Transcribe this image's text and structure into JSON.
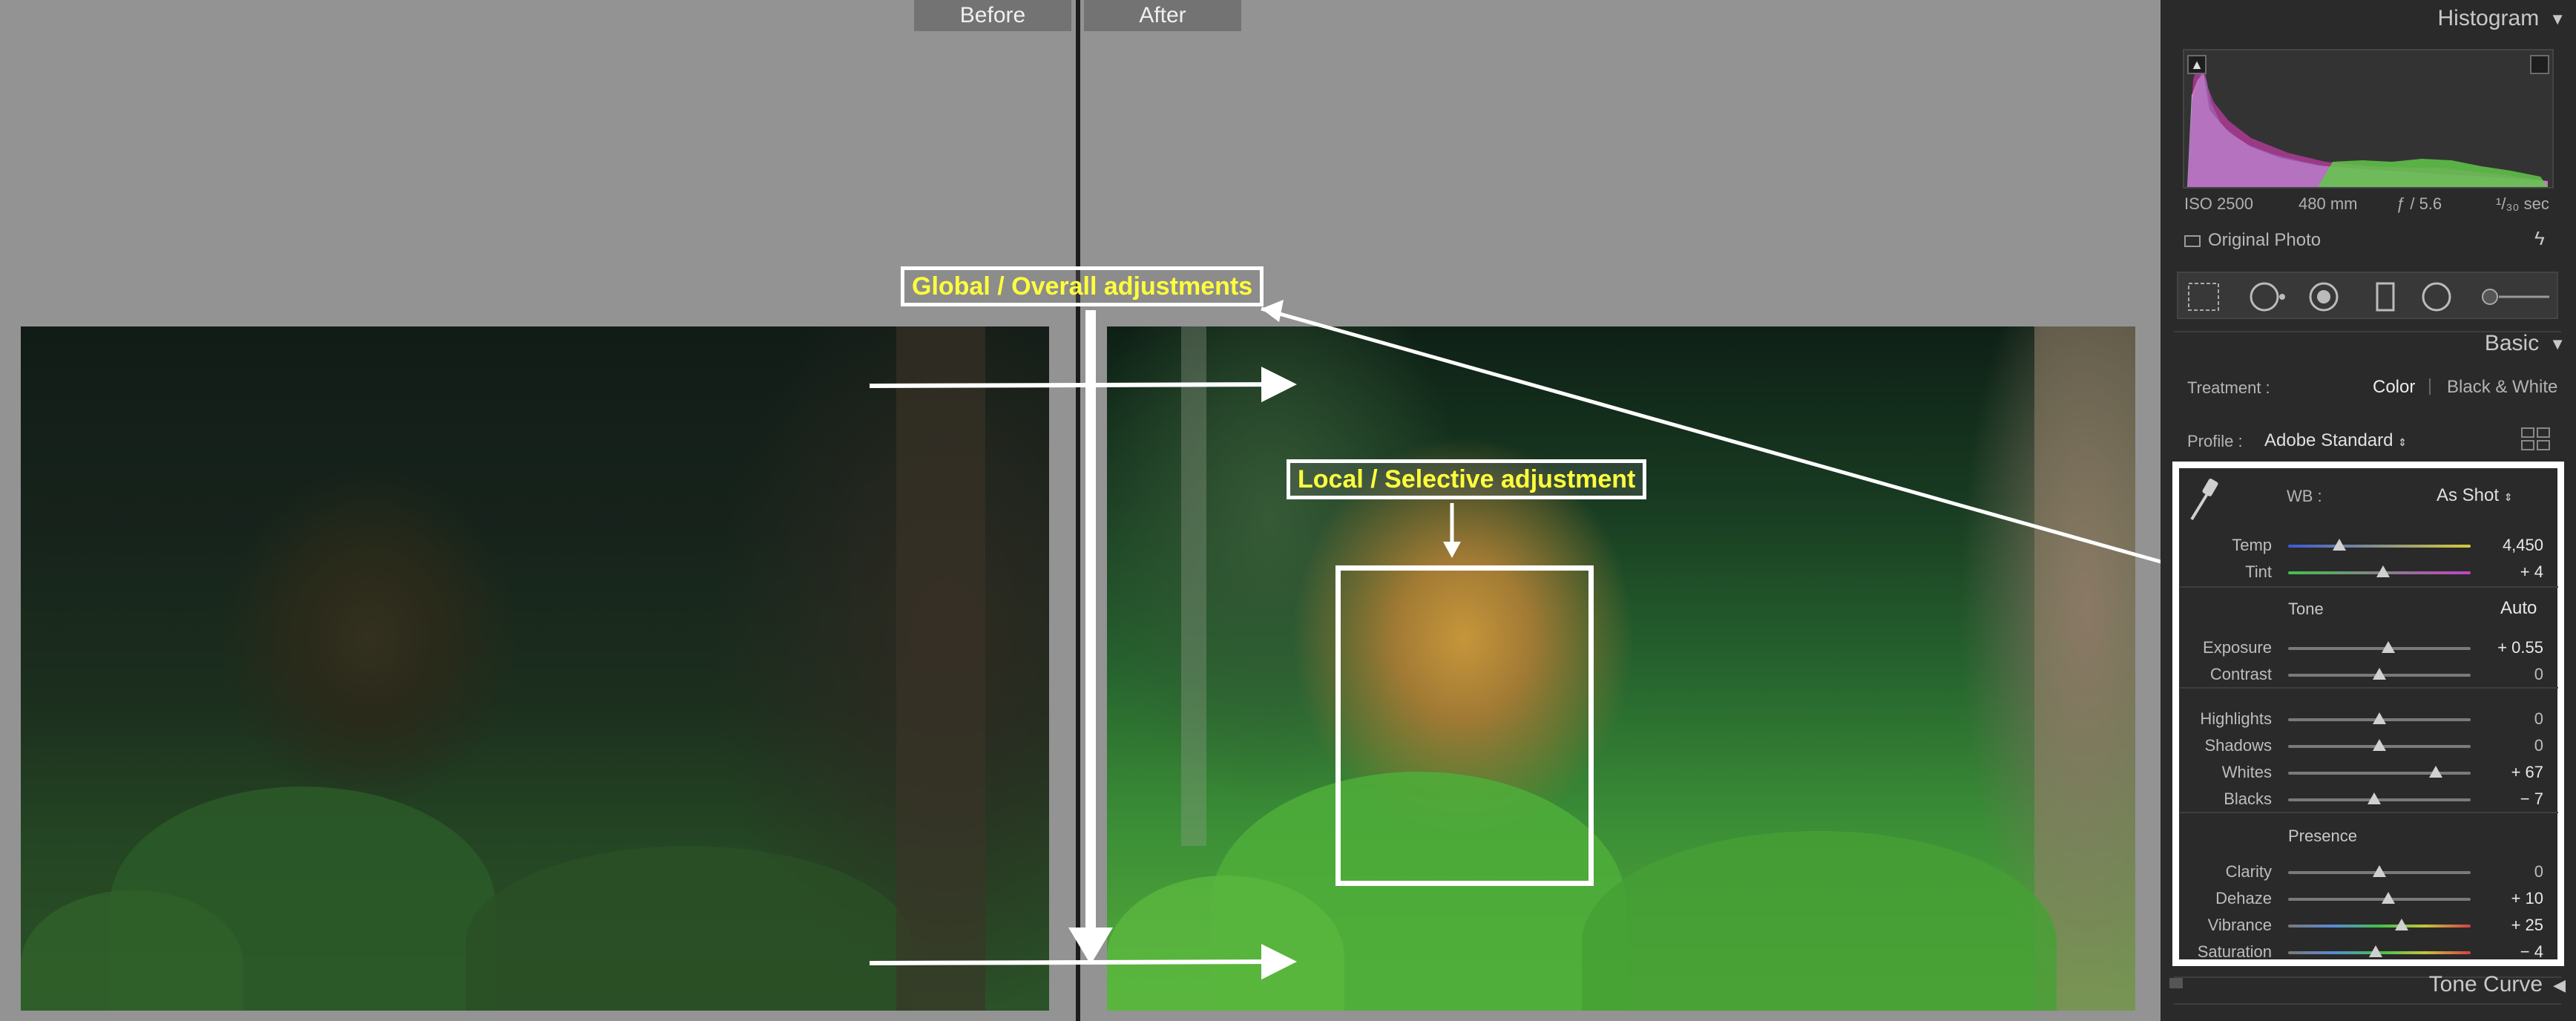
{
  "compare": {
    "before_label": "Before",
    "after_label": "After",
    "global_annotation": "Global / Overall adjustments",
    "local_annotation": "Local / Selective adjustment"
  },
  "panel": {
    "histogram_title": "Histogram",
    "exif": {
      "iso": "ISO 2500",
      "focal": "480 mm",
      "aperture": "ƒ / 5.6",
      "shutter": "¹/₃₀ sec"
    },
    "original_photo": "Original Photo",
    "basic_title": "Basic",
    "treatment_label": "Treatment :",
    "treatment_color": "Color",
    "treatment_bw": "Black & White",
    "profile_label": "Profile :",
    "profile_value": "Adobe Standard",
    "wb_label": "WB :",
    "wb_value": "As Shot",
    "tone_label": "Tone",
    "auto_label": "Auto",
    "presence_label": "Presence",
    "tone_curve_title": "Tone Curve",
    "sliders": {
      "temp": {
        "label": "Temp",
        "value": "4,450",
        "pos": 0.28
      },
      "tint": {
        "label": "Tint",
        "value": "+ 4",
        "pos": 0.52
      },
      "exposure": {
        "label": "Exposure",
        "value": "+ 0.55",
        "pos": 0.55
      },
      "contrast": {
        "label": "Contrast",
        "value": "0",
        "pos": 0.5
      },
      "highlights": {
        "label": "Highlights",
        "value": "0",
        "pos": 0.5
      },
      "shadows": {
        "label": "Shadows",
        "value": "0",
        "pos": 0.5
      },
      "whites": {
        "label": "Whites",
        "value": "+ 67",
        "pos": 0.81
      },
      "blacks": {
        "label": "Blacks",
        "value": "− 7",
        "pos": 0.47
      },
      "clarity": {
        "label": "Clarity",
        "value": "0",
        "pos": 0.5
      },
      "dehaze": {
        "label": "Dehaze",
        "value": "+ 10",
        "pos": 0.55
      },
      "vibrance": {
        "label": "Vibrance",
        "value": "+ 25",
        "pos": 0.62
      },
      "saturation": {
        "label": "Saturation",
        "value": "− 4",
        "pos": 0.48
      }
    }
  },
  "icons": {
    "collapse": "triangle-down-icon",
    "expand": "triangle-left-icon",
    "eyedropper": "eyedropper-icon",
    "flash": "flash-icon",
    "grid": "grid-icon"
  },
  "colors": {
    "annotation_text": "#ffff3c",
    "annotation_border": "#ffffff",
    "panel_bg": "#2a2a2a",
    "canvas_bg": "#939393"
  }
}
